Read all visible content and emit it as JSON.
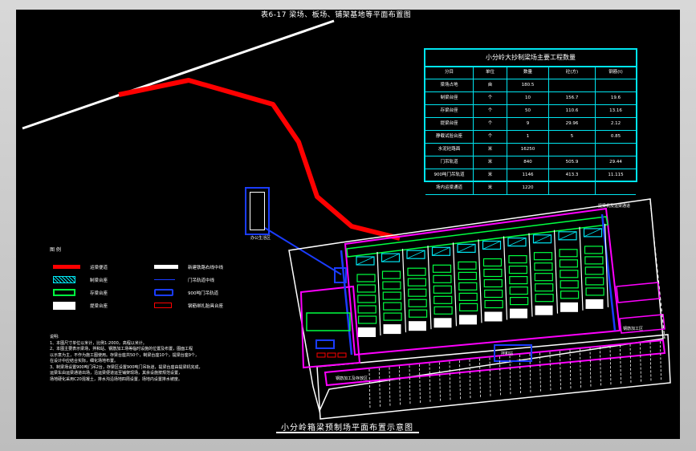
{
  "drawing": {
    "title_top": "表6-17  梁场、板场、铺架基地等平面布置图",
    "title_bottom": "小分岭箱梁预制场平面布置示意图"
  },
  "qty_table": {
    "title": "小分岭大抄制梁场主要工程数量",
    "headers": [
      "分目",
      "单位",
      "数量",
      "砼(方)",
      "钢筋(t)"
    ],
    "rows": [
      [
        "梁场占地",
        "亩",
        "180.5",
        "",
        ""
      ],
      [
        "制梁台座",
        "个",
        "10",
        "156.7",
        "19.6"
      ],
      [
        "存梁台座",
        "个",
        "50",
        "110.6",
        "13.16"
      ],
      [
        "提梁台座",
        "个",
        "9",
        "29.96",
        "2.12"
      ],
      [
        "静载试验台座",
        "个",
        "1",
        "5",
        "0.85"
      ],
      [
        "水泥砼路面",
        "米",
        "16250",
        "",
        ""
      ],
      [
        "门吊轨道",
        "米",
        "840",
        "505.9",
        "29.44"
      ],
      [
        "900吨门吊轨道",
        "米",
        "1146",
        "413.3",
        "11.115"
      ],
      [
        "场内运梁通道",
        "米",
        "1220",
        "",
        ""
      ]
    ]
  },
  "legend": {
    "heading": "图 例",
    "items": [
      {
        "symbol": "red-thick-line",
        "label": "运梁便道"
      },
      {
        "symbol": "white-thick-line",
        "label": "新建铁路右线中线"
      },
      {
        "symbol": "cyan-hatched-box",
        "label": "制梁台座"
      },
      {
        "symbol": "blue-thin-line",
        "label": "门吊轨道中线"
      },
      {
        "symbol": "green-box",
        "label": "存梁台座"
      },
      {
        "symbol": "blue-rounded-box",
        "label": "900吨门吊轨道"
      },
      {
        "symbol": "white-filled-box",
        "label": "提梁台座"
      },
      {
        "symbol": "red-outline-box",
        "label": "钢筋绑扎胎具台座"
      }
    ]
  },
  "notes": {
    "heading": "说明:",
    "lines": [
      "1、本图尺寸单位以米计，比例1:2000，高程以米计。",
      "2、本图主要表示梁场，拌和站、钢筋加工场等临时设施的位置及布置，图面工程",
      "以示意为主，不作为施工图使用。存梁台座共50个，制梁台座10个，提梁台座9个，",
      "在设计中应结合实际，细化场地布置。",
      "3、制梁场设置900吨门吊2台，存梁区设置900吨门吊轨道，提梁台座由提梁机完成，",
      "运梁车由运梁通道出场，沿运梁便道运至铺架现场，其余设施按规范设置，",
      "场地硬化采用C20混凝土，排水沟沿场地四周设置，场地内设置排水坡度。"
    ]
  },
  "site_labels": {
    "office_area": "办公生活区",
    "mixing_station": "拌和站",
    "steel_yard": "钢筋加工场",
    "top_right": "提梁机及运梁通道",
    "right_block": "钢筋加工区",
    "bottom_block": "钢筋加工及存放区",
    "center_block": "拌和站"
  },
  "colors": {
    "background": "#000000",
    "border": "#c8c8c8",
    "haul_road": "#ff0000",
    "railway_centerline": "#ffffff",
    "table_lines": "#00e5f0",
    "site_boundary": "#ff00ff",
    "storage_pedestals": "#00ff40",
    "crane_track": "#1a3cff"
  }
}
